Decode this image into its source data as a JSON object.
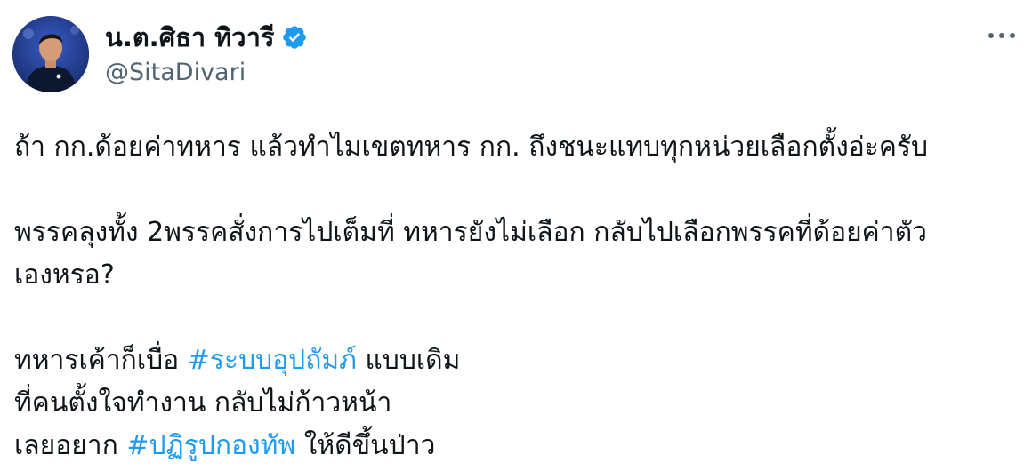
{
  "author": {
    "display_name": "น.ต.ศิธา ทิวารี",
    "handle": "@SitaDivari",
    "verified_icon": "verified-badge-icon",
    "verified_color": "#1d9bf0"
  },
  "menu": {
    "icon": "more-options-icon"
  },
  "tweet": {
    "line1": "ถ้า กก.ด้อยค่าทหาร แล้วทำไมเขตทหาร  กก. ถึงชนะแทบทุกหน่วยเลือกตั้งอ่ะครับ",
    "line2a": "พรรคลุงทั้ง 2พรรคสั่งการไปเต็มที่ ทหารยังไม่เลือก กลับไปเลือกพรรคที่ด้อยค่าตัว",
    "line2b": "เองหรอ?",
    "line3_pre": "ทหารเค้าก็เบื่อ ",
    "hashtag1": "#ระบบอุปถัมภ์",
    "line3_post": " แบบเดิม",
    "line4": "ที่คนตั้งใจทำงาน กลับไม่ก้าวหน้า",
    "line5_pre": "เลยอยาก ",
    "hashtag2": "#ปฏิรูปกองทัพ",
    "line5_post": " ให้ดีขึ้นป่าว"
  },
  "colors": {
    "text": "#0f1419",
    "secondary": "#536471",
    "link": "#1d9bf0"
  }
}
